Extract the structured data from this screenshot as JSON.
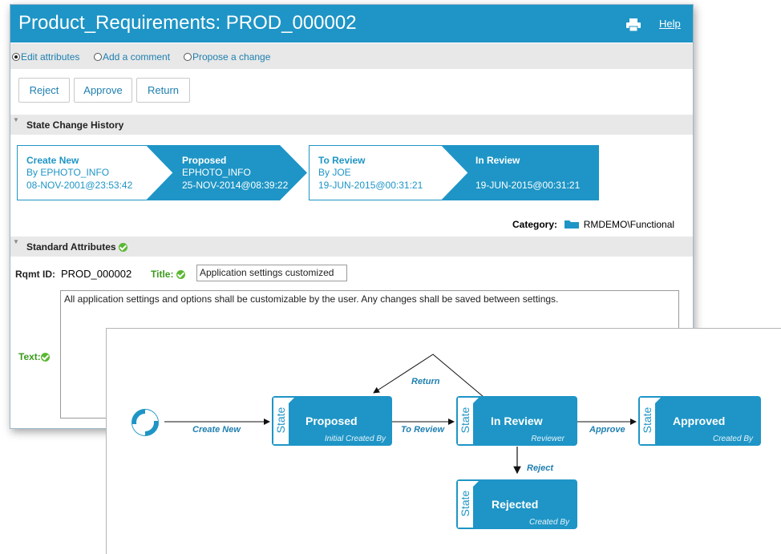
{
  "window": {
    "title": "Product_Requirements: PROD_000002",
    "help_label": "Help",
    "print_icon": "printer-icon"
  },
  "mode_options": [
    {
      "label": "Edit attributes",
      "selected": true
    },
    {
      "label": "Add a comment",
      "selected": false
    },
    {
      "label": "Propose a change",
      "selected": false
    }
  ],
  "actions": [
    "Reject",
    "Approve",
    "Return"
  ],
  "state_history": {
    "section_title": "State Change History",
    "steps": [
      {
        "title": "Create New",
        "by": "By EPHOTO_INFO",
        "date": "08-NOV-2001@23:53:42",
        "style": "outline"
      },
      {
        "title": "Proposed",
        "by": "EPHOTO_INFO",
        "date": "25-NOV-2014@08:39:22",
        "style": "filled"
      },
      {
        "title": "To Review",
        "by": "By JOE",
        "date": "19-JUN-2015@00:31:21",
        "style": "outline"
      },
      {
        "title": "In Review",
        "by": "",
        "date": "19-JUN-2015@00:31:21",
        "style": "filled"
      }
    ]
  },
  "category": {
    "label": "Category:",
    "value": "RMDEMO\\Functional",
    "icon": "folder-icon"
  },
  "standard_attributes": {
    "section_title": "Standard Attributes",
    "rqmt_id_label": "Rqmt ID:",
    "rqmt_id_value": "PROD_000002",
    "title_label": "Title:",
    "title_value": "Application settings customized",
    "text_label": "Text:",
    "text_value": "All application settings and options shall be customizable by the user. Any changes shall be saved between settings."
  },
  "workflow": {
    "state_tag": "State",
    "nodes": {
      "proposed": {
        "name": "Proposed",
        "sub": "Initial Created By"
      },
      "in_review": {
        "name": "In Review",
        "sub": "Reviewer"
      },
      "approved": {
        "name": "Approved",
        "sub": "Created By"
      },
      "rejected": {
        "name": "Rejected",
        "sub": "Created By"
      }
    },
    "transitions": {
      "create_new": "Create New",
      "to_review": "To Review",
      "approve": "Approve",
      "reject": "Reject",
      "return": "Return"
    }
  },
  "colors": {
    "accent": "#1e95c6",
    "link": "#1e7fb0",
    "ok": "#5bb733"
  }
}
